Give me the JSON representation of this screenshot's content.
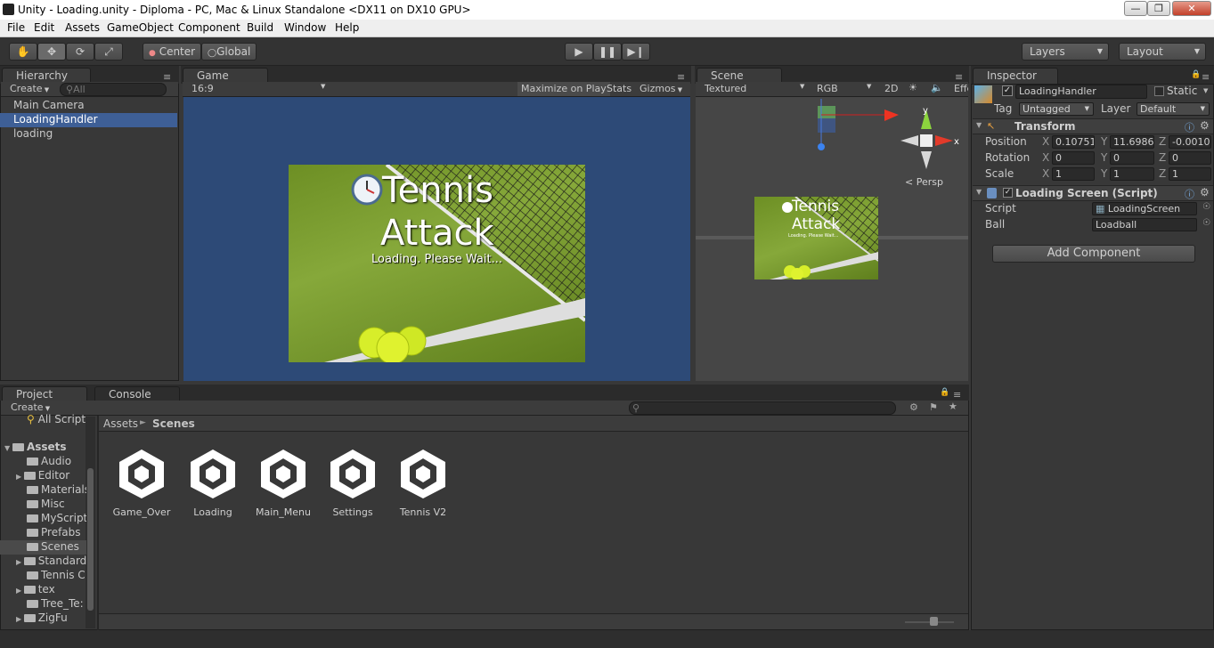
{
  "window": {
    "title": "Unity - Loading.unity - Diploma - PC, Mac & Linux Standalone <DX11 on DX10 GPU>"
  },
  "menu": [
    "File",
    "Edit",
    "Assets",
    "GameObject",
    "Component",
    "Build",
    "Window",
    "Help"
  ],
  "toolbar": {
    "pivot": "Center",
    "space": "Global",
    "layers": "Layers",
    "layout": "Layout"
  },
  "hierarchy": {
    "tab": "Hierarchy",
    "create": "Create",
    "search_placeholder": "All",
    "items": [
      {
        "label": "Main Camera",
        "selected": false
      },
      {
        "label": "LoadingHandler",
        "selected": true
      },
      {
        "label": "loading",
        "selected": false
      }
    ]
  },
  "game": {
    "tab": "Game",
    "aspect": "16:9",
    "maximize": "Maximize on Play",
    "stats": "Stats",
    "gizmos": "Gizmos",
    "title_line1": "Tennis",
    "title_line2": "Attack",
    "subtitle": "Loading. Please Wait...",
    "bg": "#2d4a77"
  },
  "scene": {
    "tab": "Scene",
    "shading": "Textured",
    "render": "RGB",
    "mode2d": "2D",
    "effects": "Effects",
    "persp": "Persp",
    "axis_x": "x",
    "axis_y": "y"
  },
  "inspector": {
    "tab": "Inspector",
    "object_name": "LoadingHandler",
    "static": "Static",
    "tag_label": "Tag",
    "tag": "Untagged",
    "layer_label": "Layer",
    "layer": "Default",
    "transform": {
      "title": "Transform",
      "position": {
        "label": "Position",
        "x": "0.10751",
        "y": "11.6986",
        "z": "-0.0010"
      },
      "rotation": {
        "label": "Rotation",
        "x": "0",
        "y": "0",
        "z": "0"
      },
      "scale": {
        "label": "Scale",
        "x": "1",
        "y": "1",
        "z": "1"
      }
    },
    "script_comp": {
      "title": "Loading Screen (Script)",
      "script_label": "Script",
      "script": "LoadingScreen",
      "ball_label": "Ball",
      "ball": "Loadball"
    },
    "add_component": "Add Component"
  },
  "project": {
    "tab": "Project",
    "console_tab": "Console",
    "create": "Create",
    "breadcrumb": [
      "Assets",
      "Scenes"
    ],
    "tree": [
      {
        "label": "All Script",
        "folder": false,
        "expand": false
      },
      {
        "label": "Assets",
        "folder": true,
        "expand": "open"
      },
      {
        "label": "Audio",
        "folder": true,
        "expand": false
      },
      {
        "label": "Editor",
        "folder": true,
        "expand": "closed"
      },
      {
        "label": "Materials",
        "folder": true,
        "expand": false
      },
      {
        "label": "Misc",
        "folder": true,
        "expand": false
      },
      {
        "label": "MyScript",
        "folder": true,
        "expand": false
      },
      {
        "label": "Prefabs",
        "folder": true,
        "expand": false
      },
      {
        "label": "Scenes",
        "folder": true,
        "expand": false,
        "selected": true
      },
      {
        "label": "Standard",
        "folder": true,
        "expand": "closed"
      },
      {
        "label": "Tennis C",
        "folder": true,
        "expand": false
      },
      {
        "label": "tex",
        "folder": true,
        "expand": "closed"
      },
      {
        "label": "Tree_Te:",
        "folder": true,
        "expand": false
      },
      {
        "label": "ZigFu",
        "folder": true,
        "expand": "closed"
      }
    ],
    "assets": [
      "Game_Over",
      "Loading",
      "Main_Menu",
      "Settings",
      "Tennis V2"
    ]
  },
  "colors": {
    "accent": "#3e5f96",
    "game_bg": "#2d4a77",
    "panel": "#383838"
  }
}
